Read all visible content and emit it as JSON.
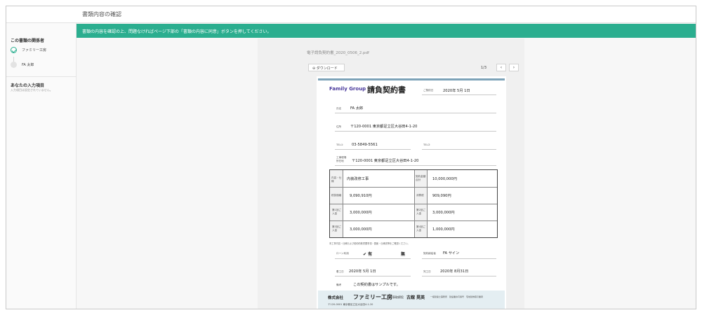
{
  "header": {
    "title": "書類内容の確認"
  },
  "sidebar": {
    "section1_title": "この書類の関係者",
    "parties": [
      {
        "name": "ファミリー工房",
        "status": "done"
      },
      {
        "name": "FA 太郎",
        "status": "pending"
      }
    ],
    "section2_title": "あなたの入力項目",
    "section2_note": "入力項目は設定されていません。"
  },
  "banner": {
    "text": "書類の内容を確認の上、問題なければページ下部の「書類の内容に同意」ボタンを押してください。"
  },
  "viewer": {
    "file_name": "電子請負契約書_2020_0506_2.pdf",
    "download_label": "⊖ ダウンロード",
    "page_indicator": "1/3",
    "prev": "‹",
    "next": "›"
  },
  "document": {
    "logo": "Family Group",
    "title": "請負契約書",
    "contract_date_label": "ご契約日",
    "contract_date": "2020年 5月 1日",
    "name_label": "氏名",
    "name": "FA 太郎",
    "address_label": "住所",
    "address": "〒120-0001 東京都足立区大谷田4-1-20",
    "tel1_label": "TEL①",
    "tel1": "03-5849-5561",
    "tel2_label": "TEL②",
    "site_label": "工事現場所在地",
    "site_address": "〒120-0001 東京都足立区大谷田4-1-20",
    "table": [
      {
        "l1": "内容・仕様",
        "v1": "内装改修工事",
        "l2": "契約金額合計",
        "v2": "10,000,000円"
      },
      {
        "l1": "税抜価格",
        "v1": "9,090,910円",
        "l2": "消費税",
        "v2": "909,090円"
      },
      {
        "l1": "第1回ご入金",
        "v1": "3,000,000円",
        "l2": "第2回ご入金",
        "v2": "3,000,000円"
      },
      {
        "l1": "第3回ご入金",
        "v1": "3,000,000円",
        "l2": "第4回ご入金",
        "v2": "1,000,000円"
      }
    ],
    "fine_print": "本工事内容・仕様および契約約款重要事項・図面・仕様書等をご確認ください。",
    "loan_label": "ローン利用",
    "loan_yes": "✔ 有",
    "loan_no": "無",
    "sign_method_label": "契約締結者",
    "sign_method": "FA サイン",
    "start_label": "着工日",
    "start_date": "2020年 5月 1日",
    "end_label": "完工日",
    "end_date": "2020年 8月31日",
    "remarks_label": "備考",
    "remarks": "この契約書はサンプルです。",
    "footer": {
      "company_prefix": "株式会社",
      "company_name": "ファミリー工房",
      "rep_label": "代表取締役",
      "rep_name": "古舘 晃英",
      "license": "一級建築士事務所　建設業許可番号　宅地建物取引業者",
      "address": "〒120-0001 東京都足立区大谷田4-1-20"
    }
  }
}
